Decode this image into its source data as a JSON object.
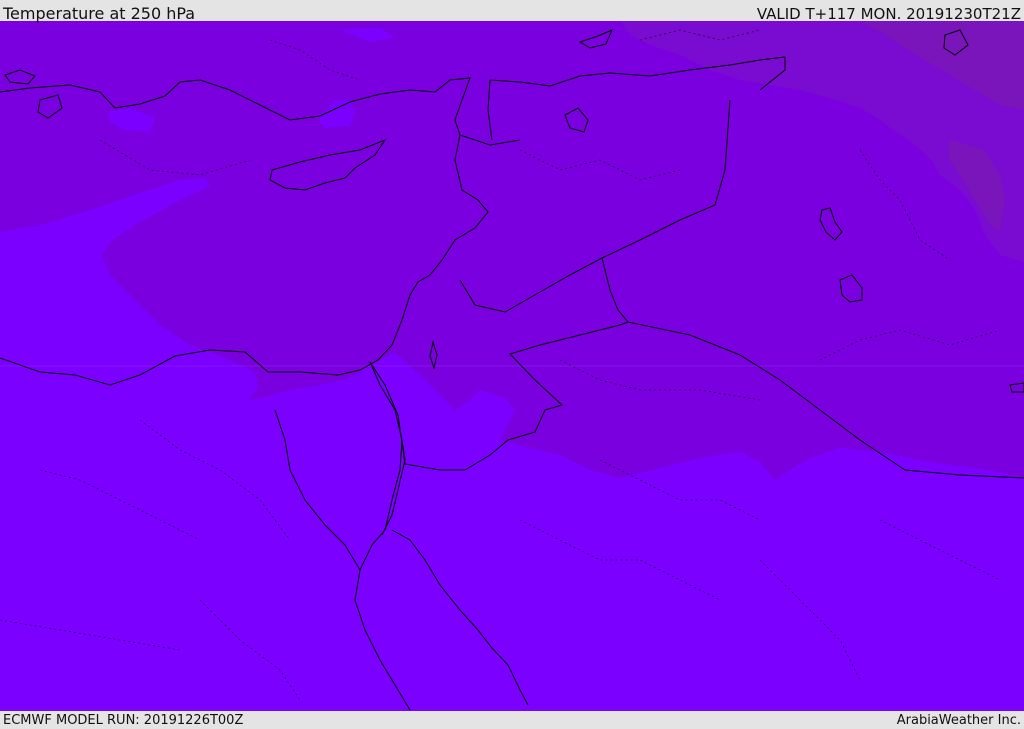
{
  "header": {
    "title": "Temperature at 250 hPa",
    "valid": "VALID T+117 MON. 20191230T21Z"
  },
  "footer": {
    "model_run": "ECMWF MODEL RUN: 20191226T00Z",
    "credit": "ArabiaWeather Inc."
  },
  "colors": {
    "band_warmest": "#7b00ff",
    "band_mid": "#7a00e0",
    "band_cold": "#7a0bd0",
    "band_coldest": "#7a14bb",
    "border_line": "#000000",
    "bar_background": "#e4e4e4"
  }
}
